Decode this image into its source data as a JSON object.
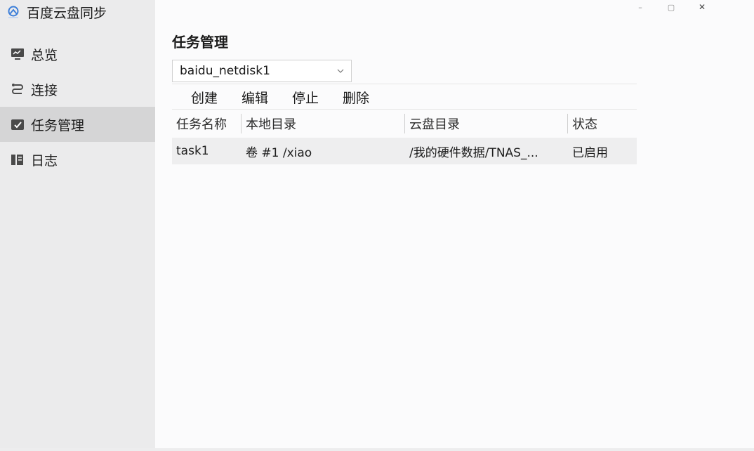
{
  "app": {
    "title": "百度云盘同步",
    "logo_icon": "baidu-cloud-icon"
  },
  "sidebar": {
    "items": [
      {
        "label": "总览",
        "icon": "monitor-icon"
      },
      {
        "label": "连接",
        "icon": "link-icon"
      },
      {
        "label": "任务管理",
        "icon": "task-check-icon",
        "active": true
      },
      {
        "label": "日志",
        "icon": "log-book-icon"
      }
    ]
  },
  "window": {
    "minimize": "–",
    "maximize": "▢",
    "close": "✕"
  },
  "main": {
    "title": "任务管理",
    "account_select": {
      "value": "baidu_netdisk1"
    },
    "toolbar": {
      "create": "创建",
      "edit": "编辑",
      "stop": "停止",
      "delete": "删除"
    },
    "table": {
      "headers": [
        "任务名称",
        "本地目录",
        "云盘目录",
        "状态"
      ],
      "rows": [
        [
          "task1",
          "卷 #1 /xiao",
          "/我的硬件数据/TNAS_...",
          "已启用"
        ]
      ]
    }
  },
  "colors": {
    "sidebar_bg": "#ebebec",
    "active_item_bg": "#d5d5d6",
    "logo_blue": "#3d7fd9"
  }
}
